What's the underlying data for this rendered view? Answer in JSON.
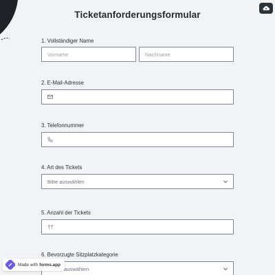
{
  "header": {
    "title": "Ticketanforderungsformular"
  },
  "fields": {
    "name": {
      "label": "1.  Vollständiger Name",
      "first_placeholder": "Vorname",
      "last_placeholder": "Nachname"
    },
    "email": {
      "label": "2. E-Mail-Adresse",
      "icon": "envelope-icon"
    },
    "phone": {
      "label": "3. Telefonnummer",
      "icon": "phone-icon"
    },
    "ticket_type": {
      "label": "4. Art des Tickets",
      "selected": "Bitte auswählen"
    },
    "ticket_count": {
      "label": "5. Anzahl der Tickets",
      "icon": "ticket-icon",
      "value": "††"
    },
    "seat_category": {
      "label": "6. Bevorzugte Sitzplatzkategorie",
      "selected": "auswählen"
    }
  },
  "footer": {
    "made_with": "Made with",
    "brand": "forms.app"
  },
  "colors": {
    "accent": "#2d333b",
    "border": "#7d8590",
    "background": "#f2f3f5",
    "brand": "#6b5ce7"
  }
}
